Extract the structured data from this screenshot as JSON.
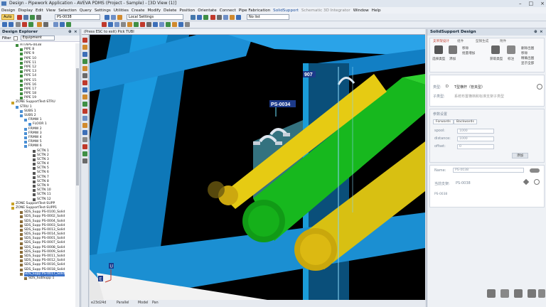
{
  "window": {
    "title": "Design - Pipework Application - AVEVA PDMS (Project - Sample) - [3D View (1)]"
  },
  "menu": [
    "Design",
    "Display",
    "Edit",
    "View",
    "Selection",
    "Query",
    "Settings",
    "Utilities",
    "Create",
    "Modify",
    "Delete",
    "Position",
    "Orientate",
    "Connect",
    "Pipe Fabrication",
    "SolidSupport",
    "Schematic 3D Integrator",
    "Window",
    "Help"
  ],
  "toolbar": {
    "mode_label": "Auto",
    "element_value": "PS-0038",
    "settings_value": "Local Settings",
    "list_value": "No list"
  },
  "explorer": {
    "title": "Design Explorer",
    "filter_label": "Filter",
    "filter_value": "Equipment",
    "rows": [
      "ATTAPS-0038",
      "PIPE 8",
      "PIPE 9",
      "PIPE 10",
      "PIPE 11",
      "PIPE 12",
      "PIPE 13",
      "PIPE 14",
      "PIPE 15",
      "PIPE 16",
      "PIPE 17",
      "PIPE 18",
      "PIPE 19",
      "ZONE SupportTest-STRU",
      "STRU 1",
      "SUBS 1",
      "SUBS 2",
      "FRMW 1",
      "FLOOR 1",
      "FRMW 2",
      "FRMW 3",
      "FRMW 4",
      "FRMW 5",
      "FRMW 6",
      "SCTN 1",
      "SCTN 2",
      "SCTN 3",
      "SCTN 4",
      "SCTN 5",
      "SCTN 6",
      "SCTN 7",
      "SCTN 8",
      "SCTN 9",
      "SCTN 10",
      "SCTN 11",
      "SCTN 12",
      "ZONE SupportTest-SUPP",
      "ZONE SupportTest-SUPP1",
      "SDS_Supp PS-0100_Solid",
      "SDS_Supp PS-0002_Solid",
      "SDS_Supp PS-0004_Solid",
      "SDS_Supp PS-0003_Solid",
      "SDS_Supp PS-0013_Solid",
      "SDS_Supp PS-0014_Solid",
      "SDS_Supp PS-0001_Solid",
      "SDS_Supp PS-0007_Solid",
      "SDS_Supp PS-0008_Solid",
      "SDS_Supp PS-0009_Solid",
      "SDS_Supp PS-0011_Solid",
      "SDS_Supp PS-0012_Solid",
      "SDS_Supp PS-0016_Solid",
      "SDS_Supp PS-0018_Solid",
      "SDS_Supp PS-0017_Solid",
      "SDS_SubSupp 1"
    ]
  },
  "view": {
    "prompt": "(Press ESC to exit) Pick TUBI",
    "tag_907": "907",
    "tag_ps": "PS-0034",
    "axis_u": "U",
    "axis_e": "E",
    "status": [
      "e23d24d",
      "Parallel",
      "Model",
      "Pan"
    ]
  },
  "solidsupport": {
    "title": "SolidSupport Design",
    "tabs": [
      "支吊架设计",
      "组件",
      "型钢生成",
      "附件"
    ],
    "buttons": [
      "选择类型",
      "添加",
      "移除",
      "批量增加",
      "获取类型",
      "标注",
      "删除出图",
      "移除",
      "精确出图",
      "显示全部"
    ],
    "type_label": "类型:",
    "type_value": "D",
    "type_name": "T型横杆（管夹型）",
    "subtype_label": "子类型:",
    "subtype_value": "系统布置横档和标准支架子类型",
    "params_label": "参数设置",
    "direction_label": "Forwards",
    "direction_label2": "Backwards",
    "spool_label": "spool:",
    "spool_value": "1000",
    "distance_label": "distance:",
    "distance_value": "1000",
    "offset_label": "offset:",
    "offset_value": "0",
    "apply_label": "添加",
    "name_label": "Name:",
    "name_value": "PS-0038",
    "tag_label": "当前支架:",
    "tag_value": "PS-0038",
    "row_value": "PS-0038"
  }
}
